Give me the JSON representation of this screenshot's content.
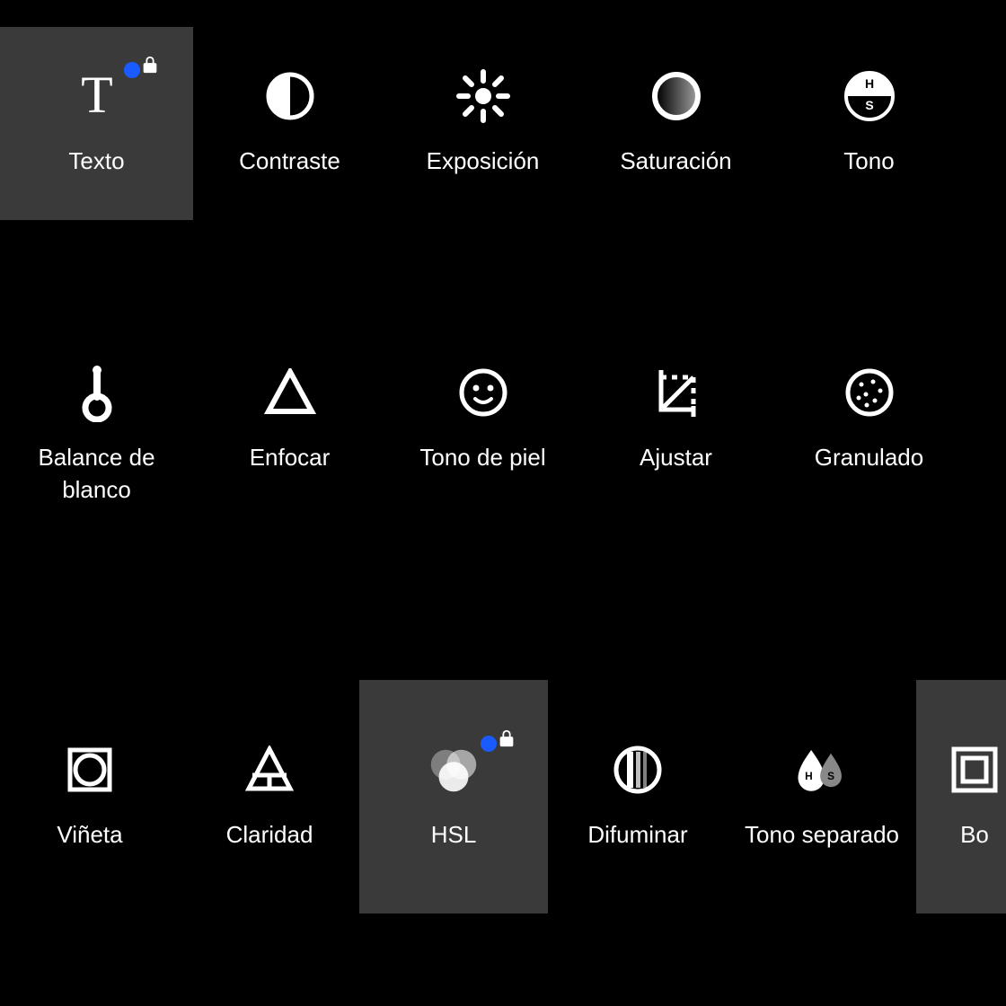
{
  "tools": {
    "texto": "Texto",
    "contraste": "Contraste",
    "exposicion": "Exposición",
    "saturacion": "Saturación",
    "tono": "Tono",
    "balance": "Balance de blanco",
    "enfocar": "Enfocar",
    "tonopiel": "Tono de piel",
    "ajustar": "Ajustar",
    "granulado": "Granulado",
    "vineta": "Viñeta",
    "claridad": "Claridad",
    "hsl": "HSL",
    "difuminar": "Difuminar",
    "tonosep": "Tono separado",
    "bo": "Bo"
  }
}
